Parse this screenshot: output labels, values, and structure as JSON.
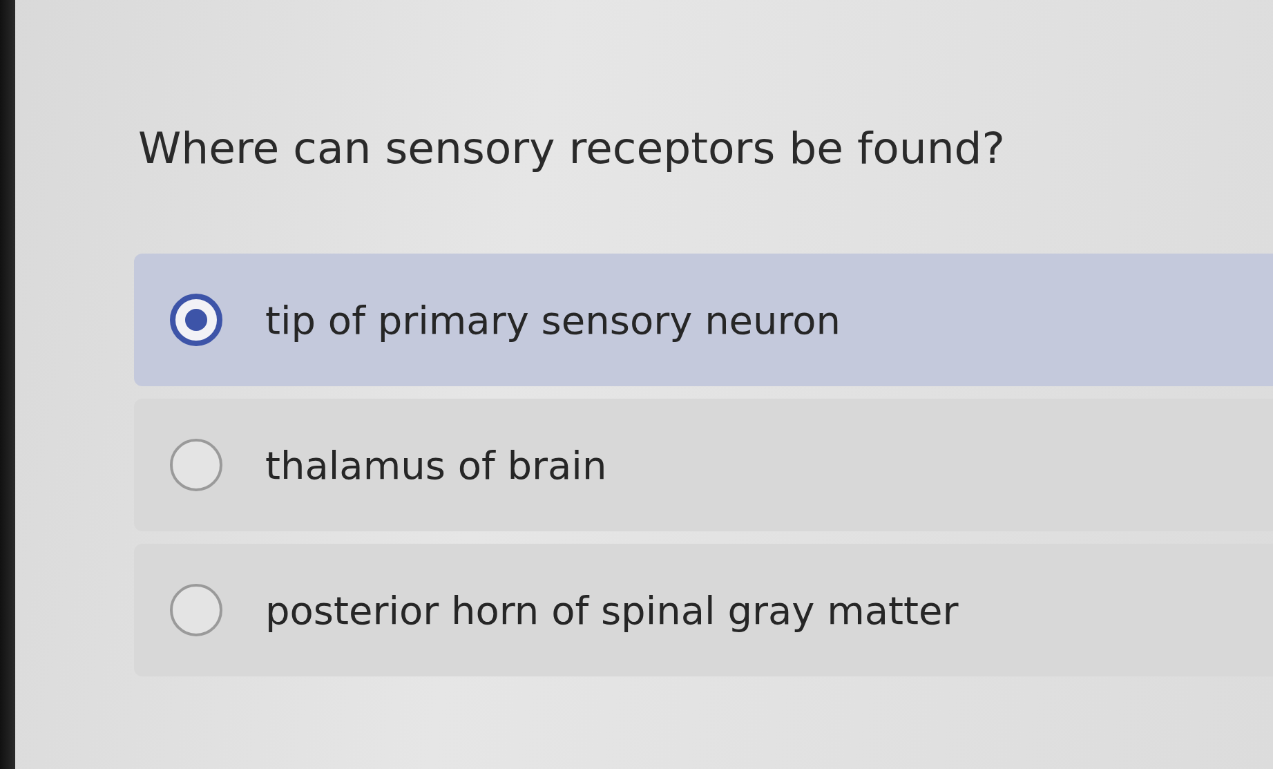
{
  "question": "Where can sensory receptors be found?",
  "options": [
    {
      "label": "tip of primary sensory neuron",
      "selected": true
    },
    {
      "label": "thalamus of brain",
      "selected": false
    },
    {
      "label": "posterior horn of spinal gray matter",
      "selected": false
    }
  ]
}
